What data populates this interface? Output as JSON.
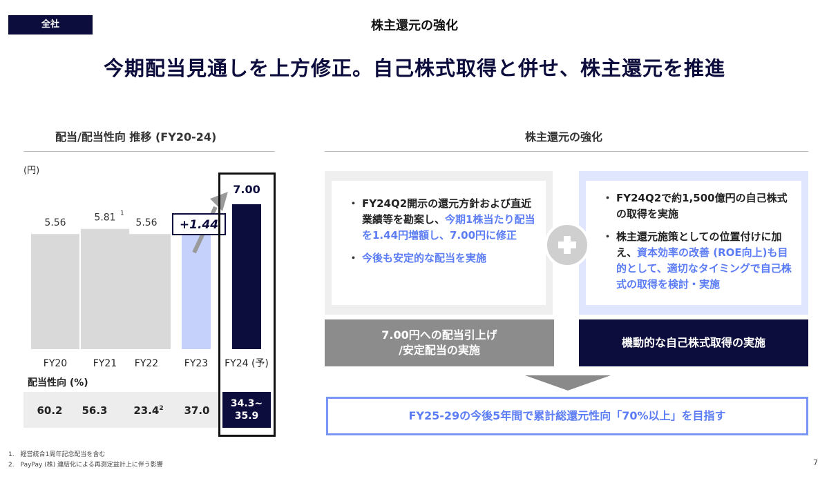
{
  "header": {
    "tag": "全社",
    "section_title": "株主還元の強化",
    "headline": "今期配当見通しを上方修正。自己株式取得と併せ、株主還元を推進"
  },
  "left_panel": {
    "title": "配当/配当性向 推移 (FY20-24)",
    "unit": "(円)",
    "increase_label": "+1.44",
    "ratio_label": "配当性向 (%)",
    "ratios": [
      {
        "value": "60.2",
        "note": ""
      },
      {
        "value": "56.3",
        "note": ""
      },
      {
        "value": "23.4",
        "note": "2"
      },
      {
        "value": "37.0",
        "note": ""
      }
    ],
    "ratio_last_line1": "34.3~",
    "ratio_last_line2": "35.9"
  },
  "chart_data": {
    "type": "bar",
    "title": "配当/配当性向 推移 (FY20-24)",
    "ylabel": "(円)",
    "categories": [
      "FY20",
      "FY21",
      "FY22",
      "FY23",
      "FY24 (予)"
    ],
    "values": [
      5.56,
      5.81,
      5.56,
      5.56,
      7.0
    ],
    "value_labels": [
      "5.56",
      "5.81",
      "5.56",
      "5.56",
      "7.00"
    ],
    "value_notes": [
      "",
      "1",
      "",
      "",
      ""
    ],
    "colors": [
      "#d9d9d9",
      "#d9d9d9",
      "#d9d9d9",
      "#c5d0fb",
      "#0d0d3d"
    ],
    "ylim": [
      0,
      7.0
    ],
    "grid": false
  },
  "right_panel": {
    "title": "株主還元の強化",
    "box_left": {
      "bullet1_plain": "FY24Q2開示の還元方針および直近業績等を勘案し、",
      "bullet1_highlight": "今期1株当たり配当を1.44円増額し、7.00円に修正",
      "bullet2": "今後も安定的な配当を実施"
    },
    "box_right": {
      "bullet1": "FY24Q2で約1,500億円の自己株式の取得を実施",
      "bullet2_plain_a": "株主還元施策としての位置付けに加え、",
      "bullet2_highlight": "資本効率の改善 (ROE向上)も目的として、適切なタイミングで自己株式の取得を検討・実施"
    },
    "action_left_line1": "7.00円への配当引上げ",
    "action_left_line2": "/安定配当の実施",
    "action_right": "機動的な自己株式取得の実施",
    "goal": "FY25-29の今後5年間で累計総還元性向「70%以上」を目指す"
  },
  "footnotes": {
    "note1": "1.　経営統合1周年記念配当を含む",
    "note2": "2.　PayPay (株) 連結化による再測定益計上に伴う影響"
  },
  "page_number": "7",
  "colors": {
    "navy": "#0d0d3d",
    "accent_blue": "#5b7cf5",
    "light_blue": "#c5d0fb",
    "grey_bar": "#d9d9d9",
    "action_grey": "#8c8c8c"
  }
}
